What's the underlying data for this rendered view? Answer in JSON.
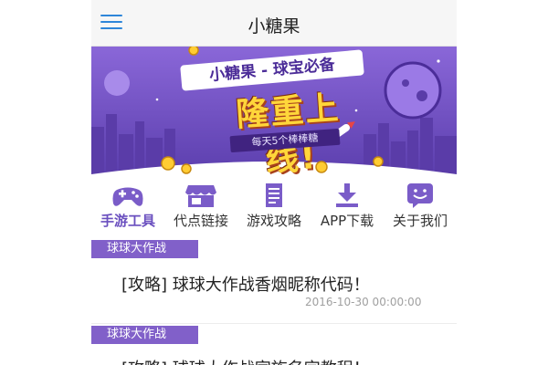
{
  "header": {
    "title": "小糖果",
    "menu_icon": "hamburger-menu-icon"
  },
  "banner": {
    "slogan": "小糖果 - 球宝必备",
    "headline": "隆重上线!",
    "tagline": "每天5个棒棒糖",
    "colors": {
      "background": "#7353c6",
      "headline": "#ffd63a"
    }
  },
  "nav": {
    "items": [
      {
        "label": "手游工具",
        "icon": "gamepad-icon",
        "active": true
      },
      {
        "label": "代点链接",
        "icon": "storefront-icon",
        "active": false
      },
      {
        "label": "游戏攻略",
        "icon": "document-icon",
        "active": false
      },
      {
        "label": "APP下载",
        "icon": "download-icon",
        "active": false
      },
      {
        "label": "关于我们",
        "icon": "smiley-chat-icon",
        "active": false
      }
    ],
    "accent": "#6a4fbf"
  },
  "articles": [
    {
      "category": "球球大作战",
      "title": "[攻略] 球球大作战香烟昵称代码！",
      "date": "2016-10-30 00:00:00"
    },
    {
      "category": "球球大作战",
      "title": "[攻略] 球球大作战家族名字教程！",
      "date": ""
    }
  ]
}
